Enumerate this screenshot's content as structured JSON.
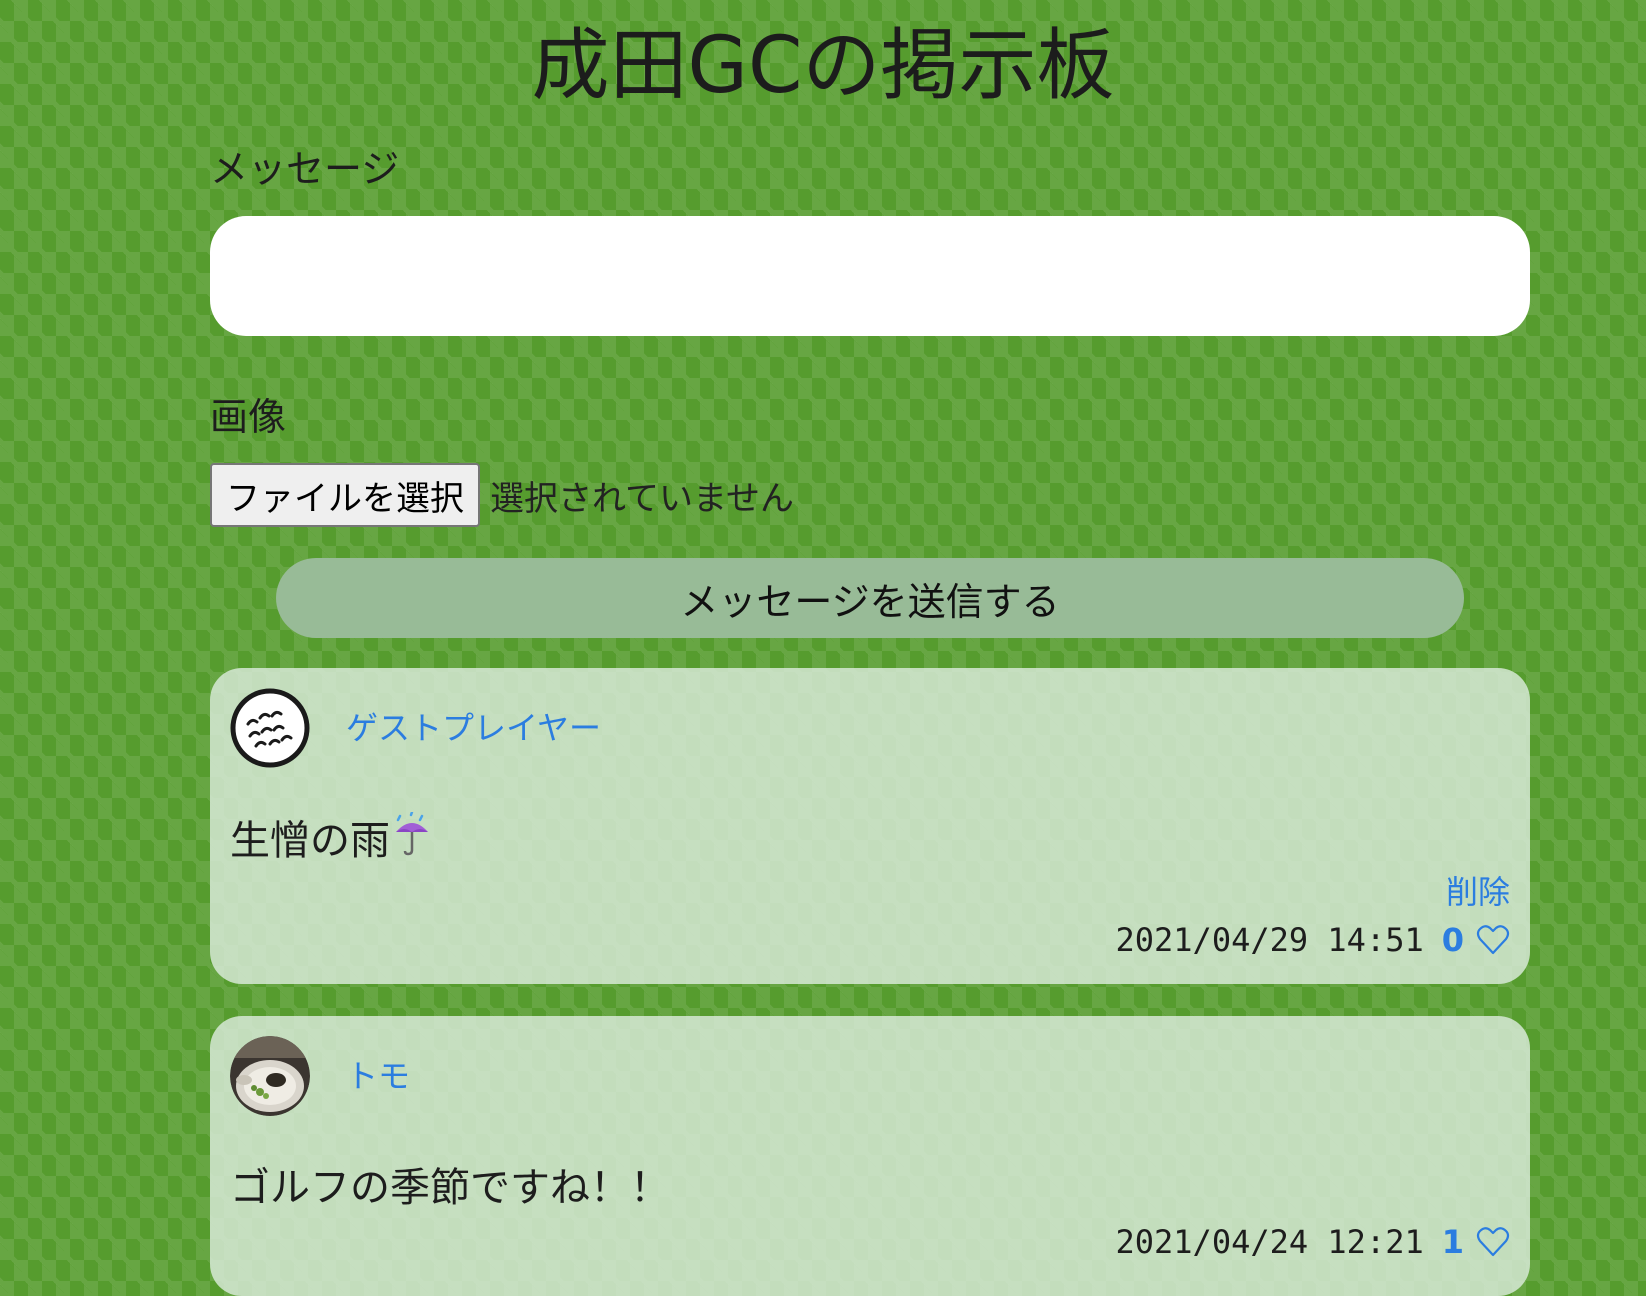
{
  "page": {
    "title": "成田GCの掲示板"
  },
  "form": {
    "message_label": "メッセージ",
    "message_value": "",
    "image_label": "画像",
    "file_button_label": "ファイルを選択",
    "file_status": "選択されていません",
    "submit_label": "メッセージを送信する"
  },
  "posts": [
    {
      "avatar_icon": "golf-ball-icon",
      "username": "ゲストプレイヤー",
      "message": "生憎の雨",
      "message_icon": "umbrella-rain-icon",
      "delete_label": "削除",
      "timestamp": "2021/04/29  14:51",
      "likes": "0",
      "like_icon": "heart-outline-icon"
    },
    {
      "avatar_icon": "ramen-photo-icon",
      "username": "トモ",
      "message": "ゴルフの季節ですね！！",
      "timestamp": "2021/04/24  12:21",
      "likes": "1",
      "like_icon": "heart-outline-icon"
    }
  ],
  "colors": {
    "background": "#569c2e",
    "link": "#2b7de0",
    "submit_button": "#98bb97",
    "card": "#d6e8d6"
  }
}
